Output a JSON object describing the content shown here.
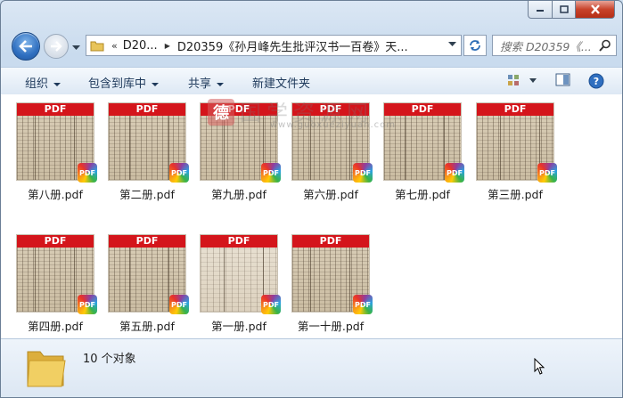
{
  "window": {
    "controls": {
      "minimize": "minimize",
      "maximize": "maximize",
      "close": "close"
    }
  },
  "navigation": {
    "overflow": "«",
    "breadcrumb_short": "D20...",
    "breadcrumb_full": "D20359《孙月峰先生批评汉书一百卷》天...",
    "search_placeholder": "搜索 D20359《...",
    "icons": [
      "back-arrow-icon",
      "forward-arrow-icon",
      "folder-icon",
      "refresh-icon",
      "search-icon"
    ]
  },
  "toolbar": {
    "organize": "组织",
    "include_in_library": "包含到库中",
    "share": "共享",
    "new_folder": "新建文件夹",
    "icons": [
      "view-options-icon",
      "preview-pane-icon",
      "help-icon"
    ]
  },
  "files": [
    {
      "name": "第八册.pdf",
      "thumb_label": "PDF",
      "badge": "PDF"
    },
    {
      "name": "第二册.pdf",
      "thumb_label": "PDF",
      "badge": "PDF"
    },
    {
      "name": "第九册.pdf",
      "thumb_label": "PDF",
      "badge": "PDF"
    },
    {
      "name": "第六册.pdf",
      "thumb_label": "PDF",
      "badge": "PDF"
    },
    {
      "name": "第七册.pdf",
      "thumb_label": "PDF",
      "badge": "PDF"
    },
    {
      "name": "第三册.pdf",
      "thumb_label": "PDF",
      "badge": "PDF"
    },
    {
      "name": "第四册.pdf",
      "thumb_label": "PDF",
      "badge": "PDF"
    },
    {
      "name": "第五册.pdf",
      "thumb_label": "PDF",
      "badge": "PDF"
    },
    {
      "name": "第一册.pdf",
      "thumb_label": "PDF",
      "badge": "PDF"
    },
    {
      "name": "第一十册.pdf",
      "thumb_label": "PDF",
      "badge": "PDF"
    }
  ],
  "watermark": {
    "logo_text": "德",
    "title": "国学资源网",
    "url": "www.guoxueziyuan.com"
  },
  "status": {
    "item_count": "10 个对象"
  },
  "colors": {
    "pdf_banner": "#d4151b",
    "window_frame": "#cfe0f1",
    "toolbar_text": "#1e395b"
  }
}
